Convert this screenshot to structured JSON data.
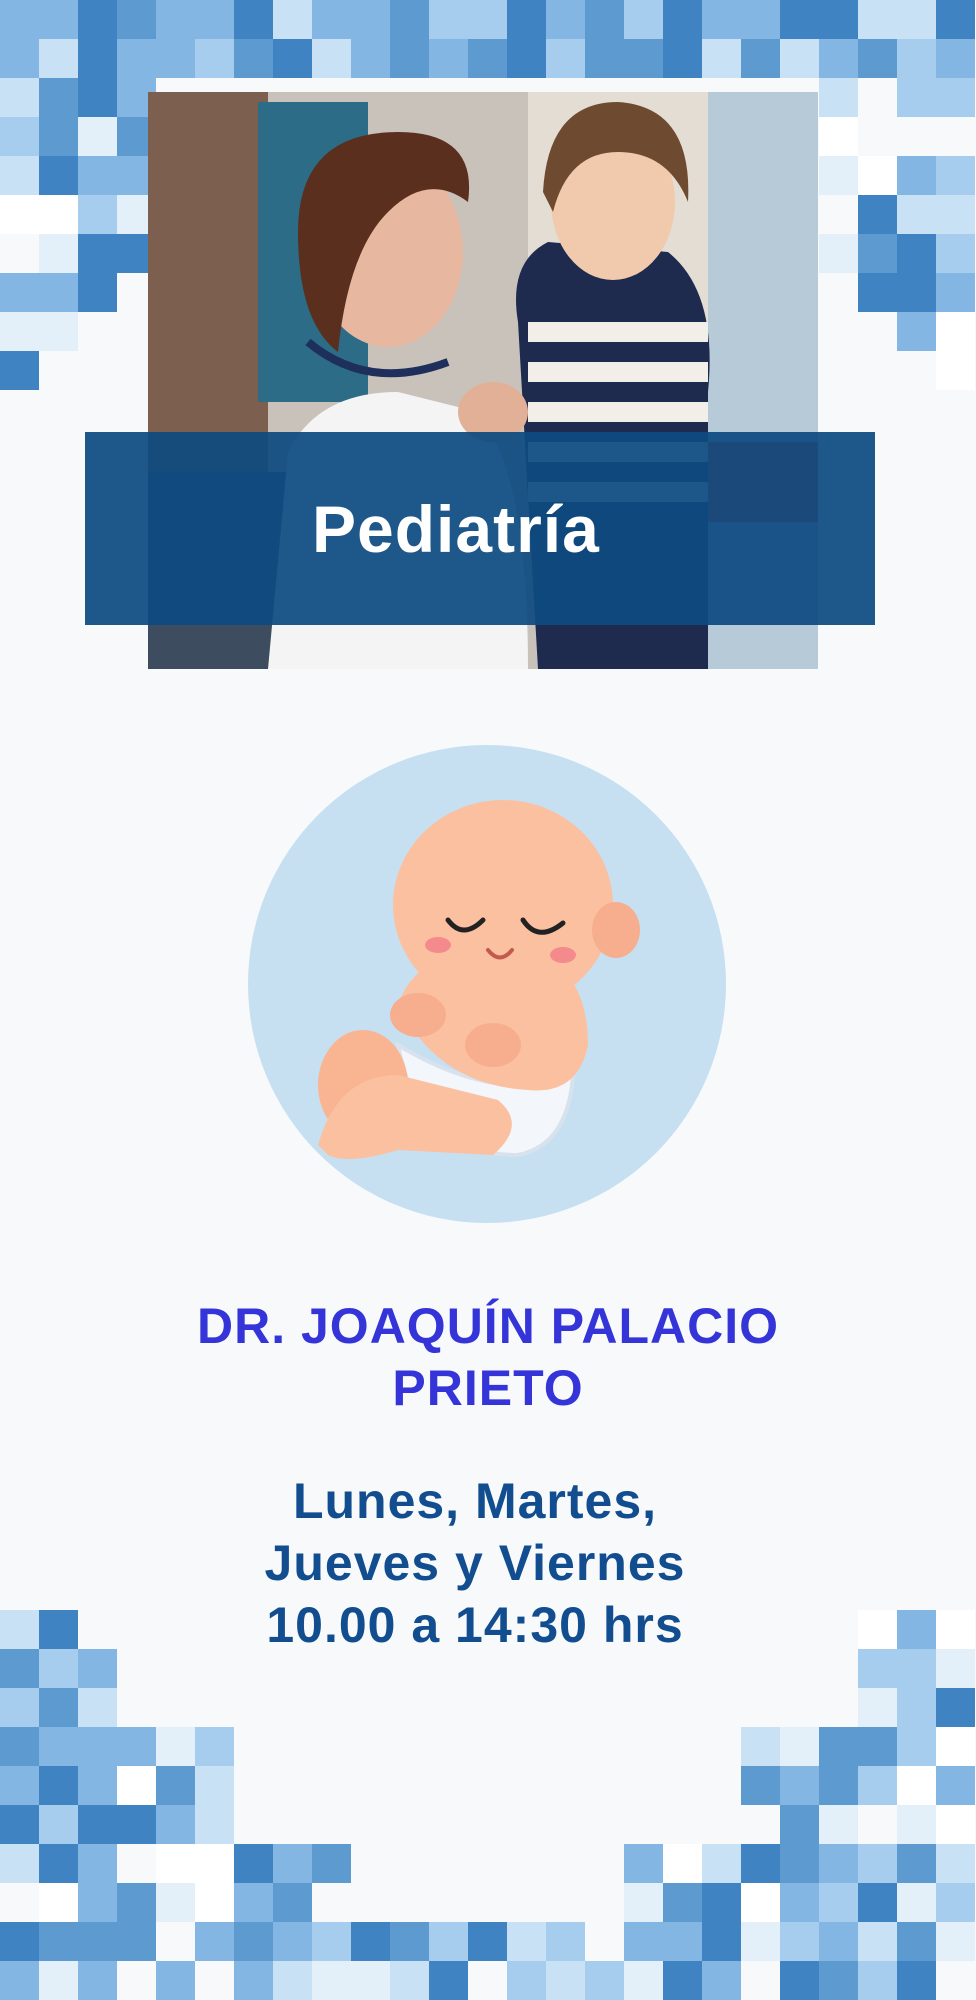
{
  "header": {
    "title": "Pediatría"
  },
  "doctor": {
    "line1": "DR. JOAQUÍN PALACIO",
    "line2": "PRIETO"
  },
  "schedule": {
    "line1": "Lunes, Martes,",
    "line2": "Jueves y Viernes",
    "line3": "10.00 a 14:30 hrs"
  },
  "colors": {
    "banner": "#0d4a80",
    "doctor_text": "#3434d8",
    "schedule_text": "#114d8f",
    "baby_circle": "#c6e0f2",
    "background": "#f7f9fb"
  },
  "icons": {
    "baby": "sleeping-baby-icon",
    "photo": "doctor-with-child-photo"
  }
}
